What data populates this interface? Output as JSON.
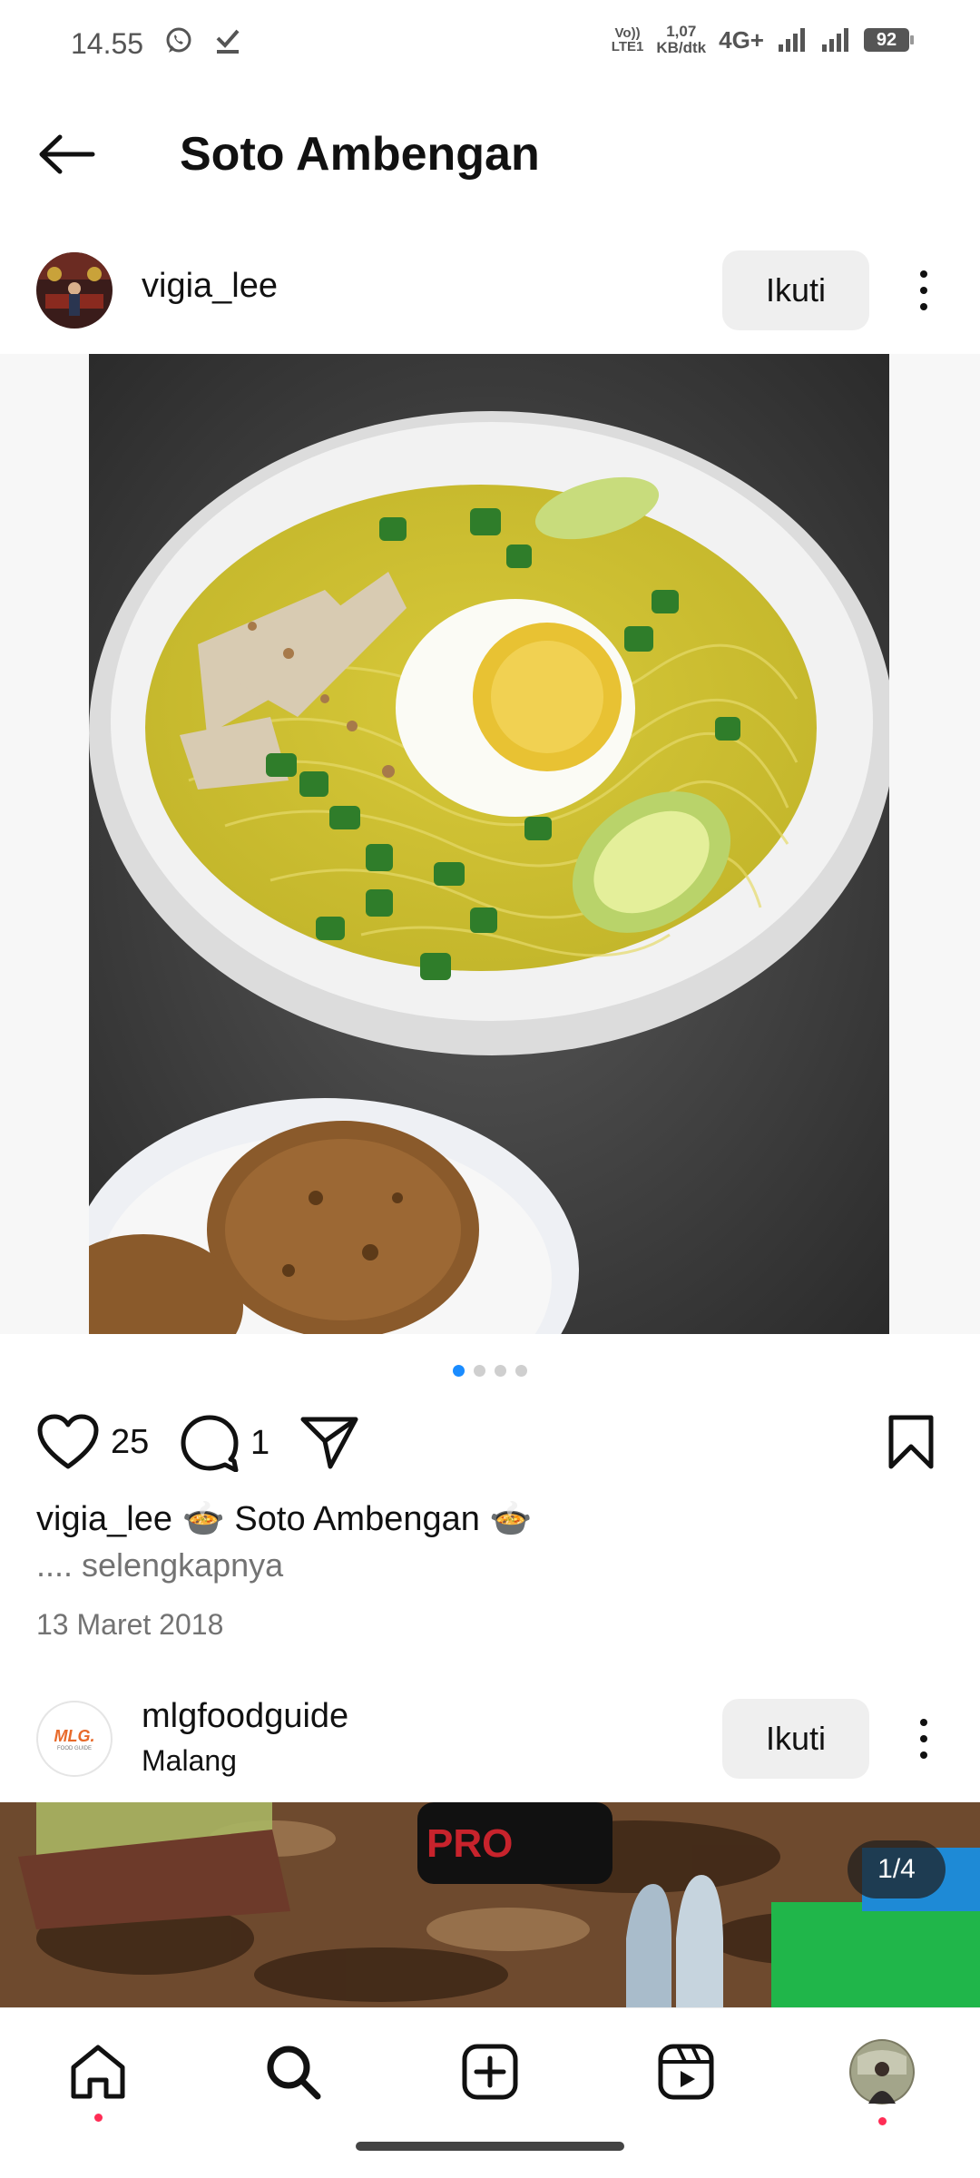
{
  "status_bar": {
    "time": "14.55",
    "volte_top": "Vo))",
    "volte_bottom": "LTE1",
    "speed_value": "1,07",
    "speed_unit": "KB/dtk",
    "network": "4G+",
    "battery": "92"
  },
  "header": {
    "title": "Soto Ambengan"
  },
  "post": {
    "username": "vigia_lee",
    "follow_label": "Ikuti",
    "likes": "25",
    "comments": "1",
    "caption_user": "vigia_lee",
    "caption_text": "🍲 Soto Ambengan 🍲",
    "more_label": ".... selengkapnya",
    "date": "13 Maret 2018",
    "carousel": {
      "count": 4,
      "active": 1
    }
  },
  "post2": {
    "username": "mlgfoodguide",
    "location": "Malang",
    "follow_label": "Ikuti",
    "counter": "1/4",
    "avatar_logo": "MLG.",
    "avatar_logo_sub": "FOOD GUIDE"
  },
  "icons": {
    "back": "back-arrow-icon",
    "like": "heart-icon",
    "comment": "comment-icon",
    "share": "send-icon",
    "save": "bookmark-icon",
    "more": "more-vertical-icon",
    "nav": [
      "home-icon",
      "search-icon",
      "create-icon",
      "reels-icon",
      "profile-avatar"
    ]
  },
  "colors": {
    "active_dot": "#1a8cff",
    "notification_dot": "#ff2d55",
    "follow_button_bg": "#efefef"
  }
}
